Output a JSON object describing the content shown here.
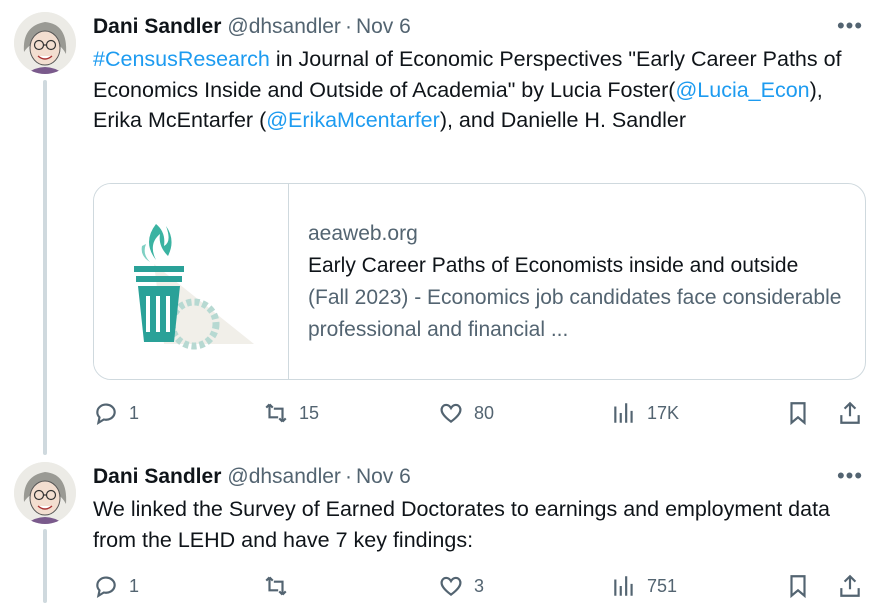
{
  "tweets": [
    {
      "author": "Dani Sandler",
      "handle": "@dhsandler",
      "separator": "·",
      "date": "Nov 6",
      "more_label": "•••",
      "text_parts": {
        "hashtag": "#CensusResearch",
        "t1": " in Journal of Economic Perspectives \"Early Career Paths of Economics Inside and Outside of Academia\" by Lucia Foster(",
        "mention1": "@Lucia_Econ",
        "t2": "), Erika McEntarfer (",
        "mention2": "@ErikaMcentarfer",
        "t3": "), and Danielle H. Sandler"
      },
      "card": {
        "domain": "aeaweb.org",
        "title": "Early Career Paths of Economists inside and outside",
        "description": "(Fall 2023) - Economics job candidates face considerable professional and financial ...",
        "thumb_icon": "torch-logo-icon"
      },
      "actions": {
        "replies": "1",
        "reposts": "15",
        "likes": "80",
        "views": "17K"
      }
    },
    {
      "author": "Dani Sandler",
      "handle": "@dhsandler",
      "separator": "·",
      "date": "Nov 6",
      "more_label": "•••",
      "text": "We linked the Survey of Earned Doctorates to earnings and employment data from the LEHD and have 7 key findings:",
      "actions": {
        "replies": "1",
        "reposts": "",
        "likes": "3",
        "views": "751"
      }
    }
  ],
  "colors": {
    "link": "#1d9bf0",
    "muted": "#536471",
    "text": "#0f1419",
    "border": "#cfd9de",
    "logo_teal": "#2aa198"
  }
}
